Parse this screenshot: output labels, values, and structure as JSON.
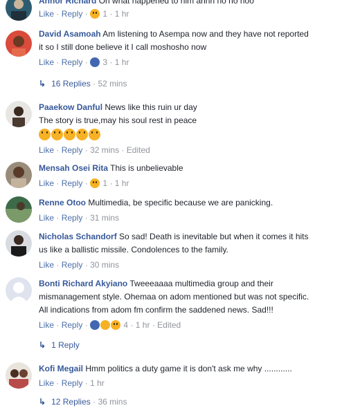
{
  "ui": {
    "like": "Like",
    "reply": "Reply",
    "dot": "·"
  },
  "comments": [
    {
      "name": "Anhor Richard",
      "text": "On what happened to him ahhh no no noo",
      "reactions": "1",
      "time": "1 hr",
      "edited": ""
    },
    {
      "name": "David Asamoah",
      "text1": "Am listening to Asempa now and they have not reported",
      "text2": "it so I still done believe it I call moshosho now",
      "reactions": "3",
      "time": "1 hr",
      "replies": "16 Replies",
      "replies_time": "52 mins"
    },
    {
      "name": "Paaekow Danful",
      "text1": "News like this ruin ur day",
      "text2": "The story is true,may his soul rest in peace",
      "time": "32 mins",
      "edited": "Edited"
    },
    {
      "name": "Mensah Osei Rita",
      "text": "This is unbelievable",
      "reactions": "1",
      "time": "1 hr"
    },
    {
      "name": "Renne Otoo",
      "text": "Multimedia, be specific because we are panicking.",
      "time": "31 mins"
    },
    {
      "name": "Nicholas Schandorf",
      "text1": "So sad! Death is inevitable but when it comes it hits",
      "text2": "us like a ballistic missile. Condolences to the family.",
      "time": "30 mins"
    },
    {
      "name": "Bonti Richard Akyiano",
      "text1": "Tweeeaaaa multimedia group and their",
      "text2": "mismanagement style. Ohemaa on adom mentioned but was not specific.",
      "text3": "All indications from adom fm confirm the saddened news. Sad!!!",
      "reactions": "4",
      "time": "1 hr",
      "edited": "Edited",
      "replies": "1 Reply"
    },
    {
      "name": "Kofi Megail",
      "text": "Hmm politics a duty game it is don't ask me why ............",
      "time": "1 hr",
      "replies": "12 Replies",
      "replies_time": "36 mins"
    }
  ],
  "colors": {
    "name": "#365899",
    "meta": "#90949c",
    "link": "#4b6fa8"
  }
}
